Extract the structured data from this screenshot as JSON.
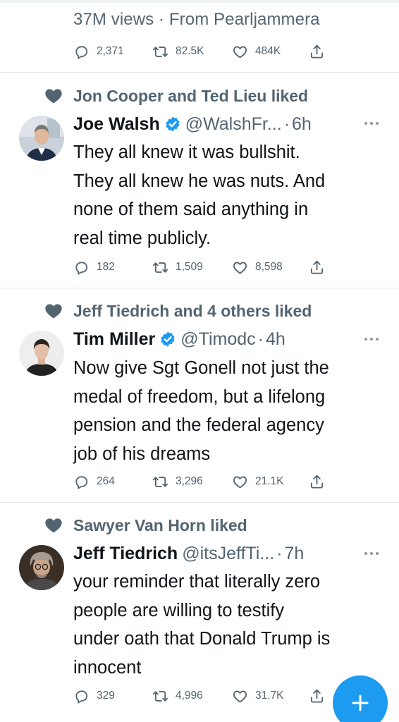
{
  "top": {
    "views_line": "37M views · From Pearljammera",
    "reply_count": "2,371",
    "retweet_count": "82.5K",
    "like_count": "484K"
  },
  "tweets": [
    {
      "social_context": "Jon Cooper and Ted Lieu liked",
      "name": "Joe Walsh",
      "verified": true,
      "handle": "@WalshFr...",
      "dot": "·",
      "time": "6h",
      "lines": [
        "They all knew it was bullshit.",
        "They all knew he was nuts. And",
        "none of them said anything in",
        "real time publicly."
      ],
      "reply_count": "182",
      "retweet_count": "1,509",
      "like_count": "8,598"
    },
    {
      "social_context": "Jeff Tiedrich and 4 others liked",
      "name": "Tim Miller",
      "verified": true,
      "handle": "@Timodc",
      "dot": "·",
      "time": "4h",
      "lines": [
        "Now give Sgt Gonell not just the",
        "medal of freedom, but a lifelong",
        "pension and the federal agency",
        "job of his dreams"
      ],
      "reply_count": "264",
      "retweet_count": "3,296",
      "like_count": "21.1K"
    },
    {
      "social_context": "Sawyer Van Horn liked",
      "name": "Jeff Tiedrich",
      "verified": false,
      "handle": "@itsJeffTi...",
      "dot": "·",
      "time": "7h",
      "lines": [
        "your reminder that literally zero",
        "people are willing to testify",
        "under oath that Donald Trump is",
        "innocent"
      ],
      "reply_count": "329",
      "retweet_count": "4,996",
      "like_count": "31.7K"
    }
  ],
  "colors": {
    "accent": "#1d9bf0",
    "secondary_text": "#536471",
    "primary_text": "#0f1419"
  },
  "icons": {
    "reply": "reply-icon",
    "retweet": "retweet-icon",
    "like": "heart-icon",
    "share": "share-icon",
    "more": "more-icon",
    "compose": "plus-icon"
  }
}
